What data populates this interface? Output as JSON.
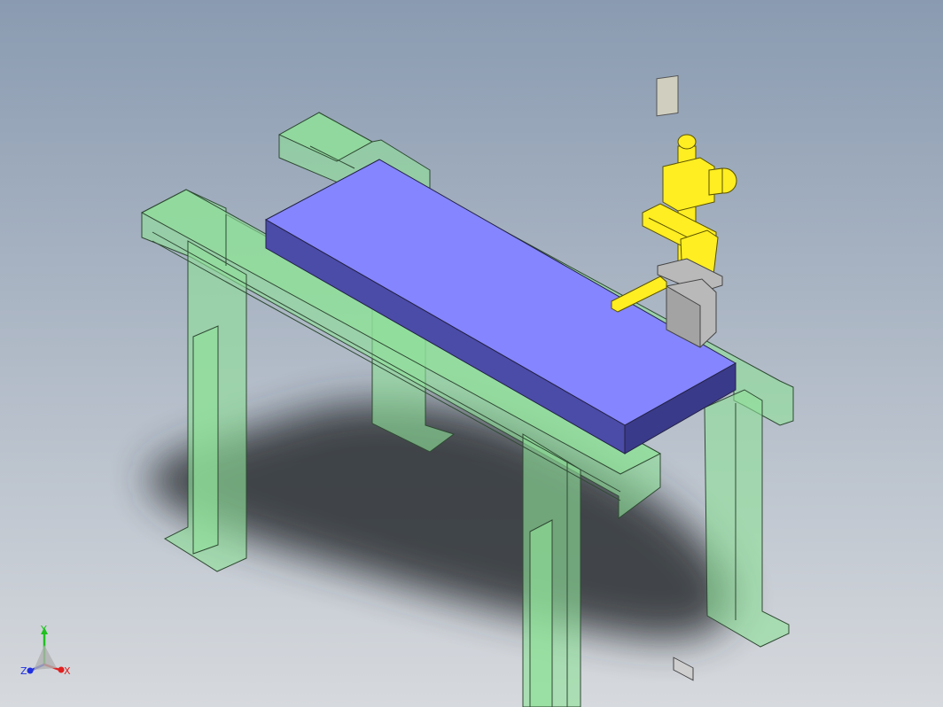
{
  "viewport": {
    "background_top": "#8a9bb1",
    "background_bottom": "#d6d9dd"
  },
  "colors": {
    "frame_fill": "#8fe09a",
    "frame_edge": "#2f4a33",
    "workpiece_top": "#8585ff",
    "workpiece_front": "#4b4ba8",
    "workpiece_side": "#3a3a8a",
    "robot_yellow": "#ffee22",
    "robot_edge": "#5a5200",
    "gripper_gray": "#b9b9b9",
    "shadow": "#2c2f33"
  },
  "triad": {
    "x_label": "X",
    "y_label": "Y",
    "z_label": "Z",
    "x_color": "#e02020",
    "y_color": "#20c020",
    "z_color": "#2030e0"
  }
}
